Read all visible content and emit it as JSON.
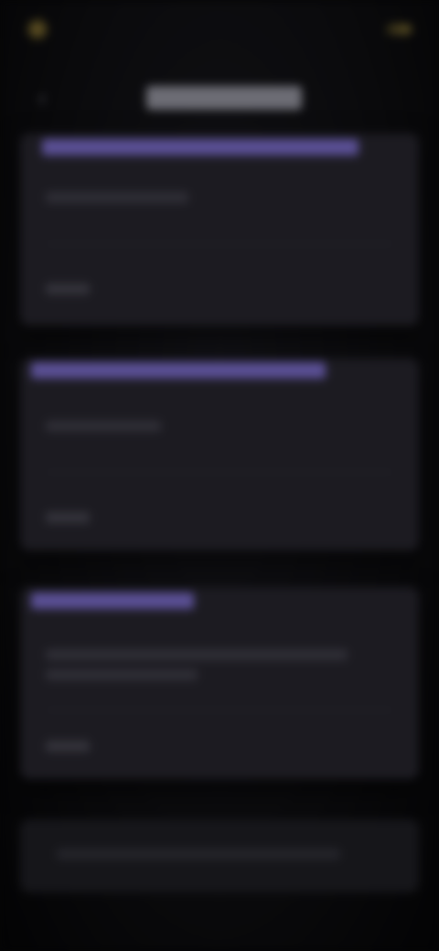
{
  "header": {
    "brand": "",
    "action_label": ""
  },
  "page": {
    "title": "",
    "back_icon": "chevron-left-icon"
  },
  "cards": [
    {
      "heading": "",
      "subtitle": "",
      "meta": ""
    },
    {
      "heading": "",
      "subtitle": "",
      "meta": ""
    },
    {
      "heading": "",
      "subtitle": "",
      "meta": ""
    }
  ],
  "bottom": {
    "placeholder": ""
  },
  "colors": {
    "accent_gold": "#b9a464",
    "accent_purple": "#5a4f94",
    "card_bg": "#1c1b21",
    "page_bg": "#0a0a0c"
  }
}
